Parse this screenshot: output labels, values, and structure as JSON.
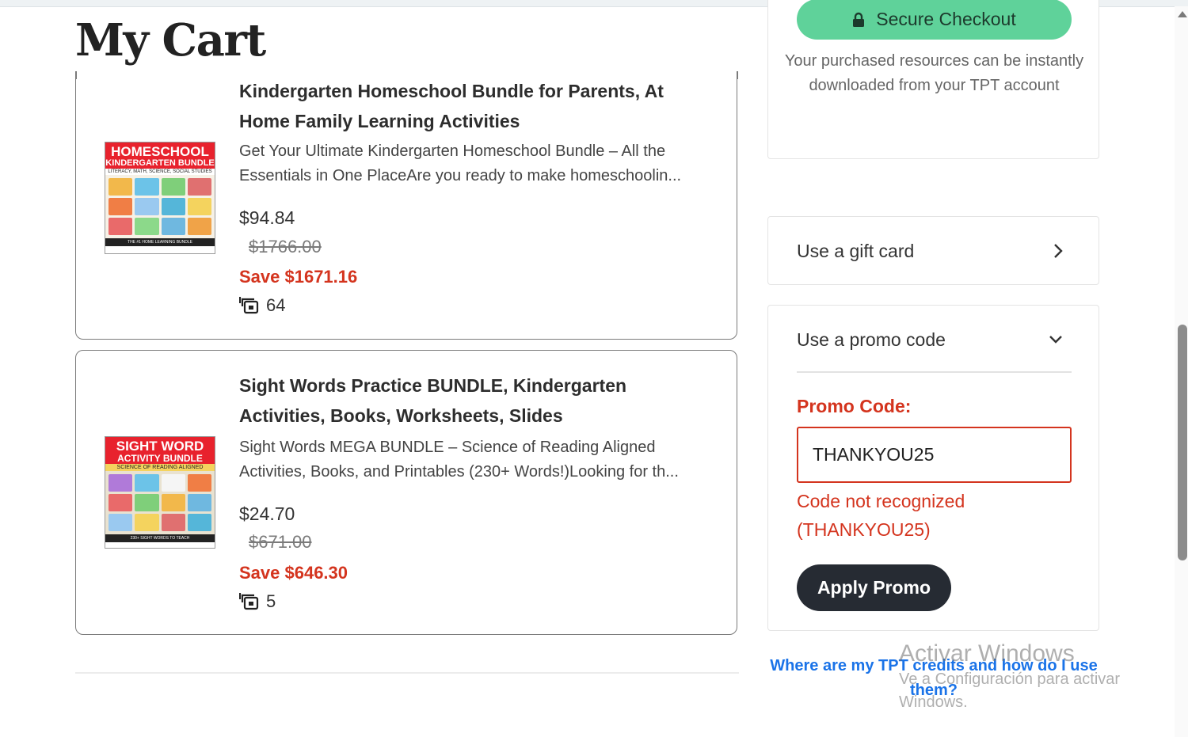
{
  "page": {
    "title": "My Cart"
  },
  "cart": {
    "items": [
      {
        "title": "Kindergarten Homeschool Bundle for Parents, At Home Family Learning Activities",
        "description_lines": [
          "Get Your Ultimate Kindergarten Homeschool Bundle – All the",
          "Essentials in One PlaceAre you ready to make homeschoolin..."
        ],
        "price": "$94.84",
        "original_price": "$1766.00",
        "savings": "Save $1671.16",
        "resource_count": "64",
        "thumbnail": {
          "line1": "HOMESCHOOL",
          "line2": "KINDERGARTEN BUNDLE",
          "line3": "LITERACY, MATH, SCIENCE, SOCIAL STUDIES",
          "footer": "THE #1 HOME LEARNING BUNDLE"
        }
      },
      {
        "title": "Sight Words Practice BUNDLE, Kindergarten Activities, Books, Worksheets, Slides",
        "description_lines": [
          "Sight Words MEGA BUNDLE – Science of Reading Aligned",
          "Activities, Books, and Printables (230+ Words!)Looking for th..."
        ],
        "price": "$24.70",
        "original_price": "$671.00",
        "savings": "Save $646.30",
        "resource_count": "5",
        "thumbnail": {
          "line1": "SIGHT WORD",
          "line2": "ACTIVITY BUNDLE",
          "line3": "SCIENCE OF READING ALIGNED",
          "footer": "230+ SIGHT WORDS TO TEACH"
        }
      }
    ]
  },
  "sidebar": {
    "checkout_label": "Secure Checkout",
    "checkout_icon": "lock-icon",
    "checkout_note": "Your purchased resources can be instantly downloaded from your TPT account",
    "gift_card_label": "Use a gift card",
    "promo_toggle_label": "Use a promo code",
    "promo_field_label": "Promo Code:",
    "promo_value": "THANKYOU25",
    "promo_error_line1": "Code not recognized",
    "promo_error_line2": "(THANKYOU25)",
    "apply_label": "Apply Promo",
    "credits_link": "Where are my TPT credits and how do I use them?"
  },
  "watermark": {
    "line1": "Activar Windows",
    "line2": "Ve a Configuración para activar",
    "line3": "Windows."
  },
  "colors": {
    "accent_green": "#5fd29a",
    "error_red": "#d4341e",
    "dark_button": "#262b33",
    "link_blue": "#1a73e8"
  }
}
